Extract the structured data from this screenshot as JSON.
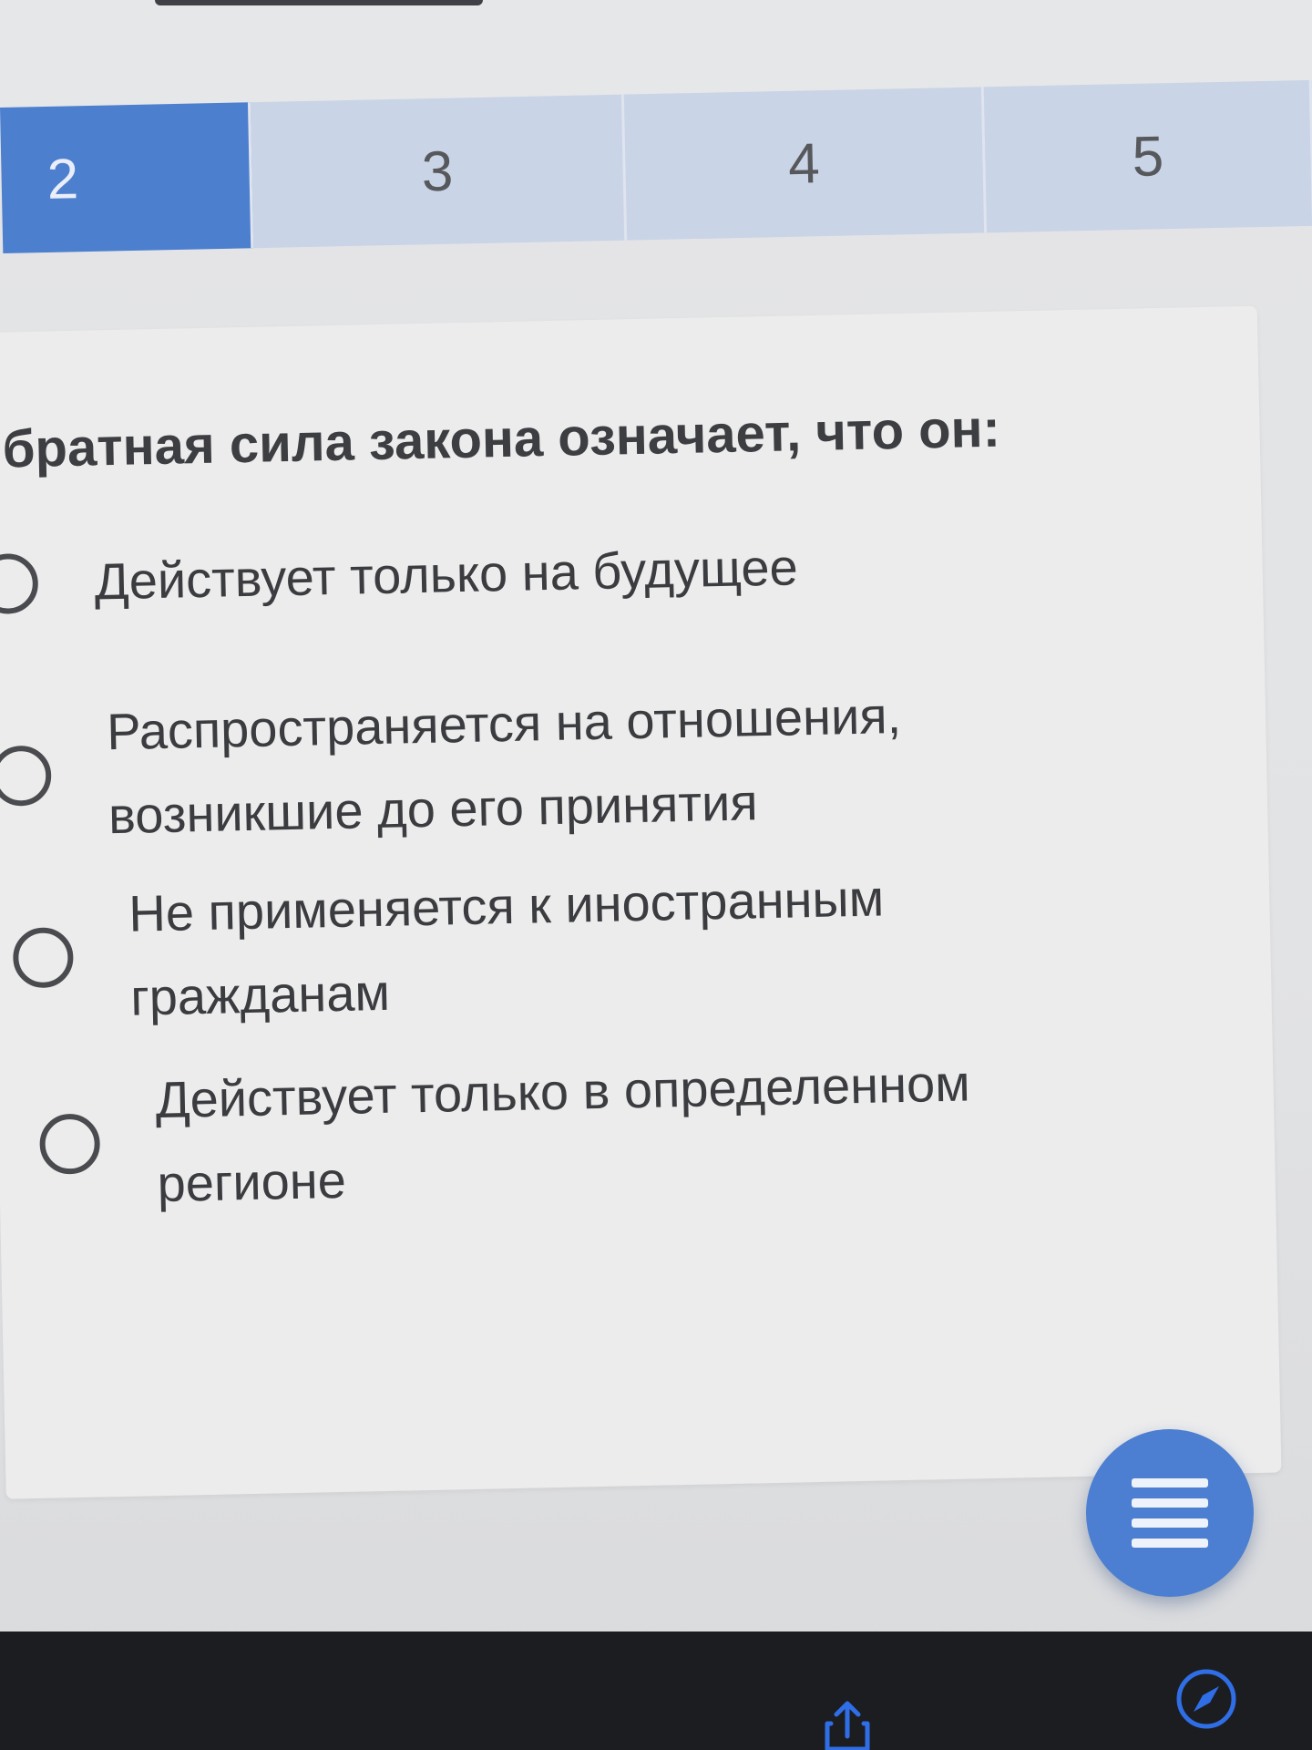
{
  "tabs": [
    {
      "label": "2",
      "active": true
    },
    {
      "label": "3",
      "active": false
    },
    {
      "label": "4",
      "active": false
    },
    {
      "label": "5",
      "active": false
    }
  ],
  "question": {
    "text": "братная сила закона означает, что он:",
    "options": [
      {
        "label": "Действует только на будущее",
        "selected": false
      },
      {
        "label": "Распространяется на отношения, возникшие до его принятия",
        "selected": false
      },
      {
        "label": "Не применяется к иностранным гражданам",
        "selected": false
      },
      {
        "label": "Действует только в определенном регионе",
        "selected": false
      }
    ]
  },
  "colors": {
    "accent": "#4d7fcf",
    "tab_inactive": "#c9d4e6",
    "card": "#ececed",
    "browser_bar": "#1c1d20",
    "browser_icon": "#2f6ee6"
  },
  "icons": {
    "menu": "hamburger-menu-icon",
    "share": "share-icon",
    "browser": "compass-icon"
  }
}
